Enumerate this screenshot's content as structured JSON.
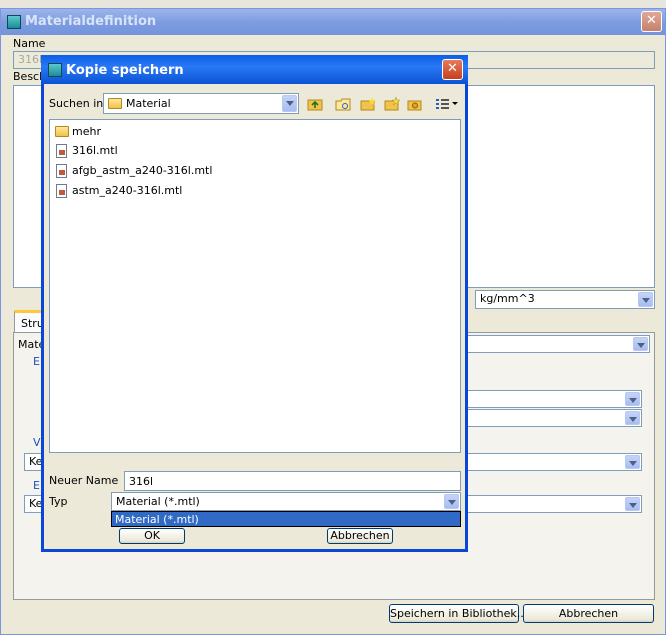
{
  "parent": {
    "title": "Materialdefinition",
    "name_label": "Name",
    "name_value": "316L",
    "desc_label": "Besch",
    "unit_value": "kg/mm^3",
    "tab_label": "Stru",
    "mat_label": "Mate",
    "label_e1": "E",
    "label_v": "V",
    "label_e2": "E",
    "combo_ke1": "Ke",
    "combo_ke2": "Ke",
    "btn_save_lib": "Speichern in Bibliothek...",
    "btn_cancel": "Abbrechen"
  },
  "dialog": {
    "title": "Kopie speichern",
    "look_in_label": "Suchen in",
    "look_in_value": "Material",
    "files": [
      {
        "name": "mehr",
        "icon": "folder-icon"
      },
      {
        "name": "316l.mtl",
        "icon": "file-icon"
      },
      {
        "name": "afgb_astm_a240-316l.mtl",
        "icon": "file-icon"
      },
      {
        "name": "astm_a240-316l.mtl",
        "icon": "file-icon"
      }
    ],
    "new_name_label": "Neuer Name",
    "new_name_value": "316l",
    "type_label": "Typ",
    "type_value": "Material (*.mtl)",
    "type_options": [
      "Material (*.mtl)"
    ],
    "ok_label": "OK",
    "cancel_label": "Abbrechen"
  }
}
